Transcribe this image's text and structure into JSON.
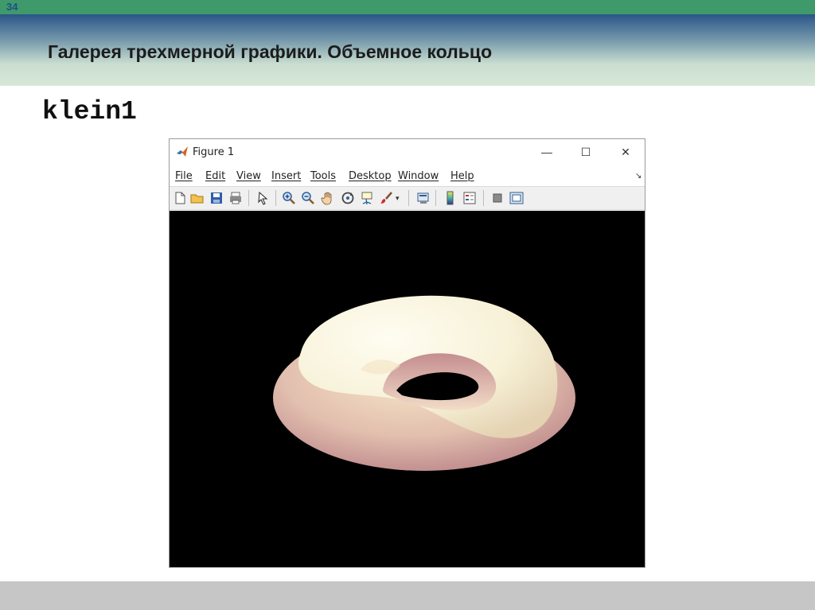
{
  "slide": {
    "number": "34",
    "title": "Галерея трехмерной графики. Объемное кольцо",
    "command": "klein1"
  },
  "figure_window": {
    "title": "Figure 1",
    "controls": {
      "minimize": "—",
      "maximize": "☐",
      "close": "✕"
    },
    "menu": [
      "File",
      "Edit",
      "View",
      "Insert",
      "Tools",
      "Desktop",
      "Window",
      "Help"
    ],
    "dock_arrow": "↘",
    "toolbar_icons": [
      "new-figure-icon",
      "open-file-icon",
      "save-icon",
      "print-icon",
      "edit-plot-arrow-icon",
      "zoom-in-icon",
      "zoom-out-icon",
      "pan-hand-icon",
      "rotate-3d-icon",
      "data-cursor-icon",
      "brush-icon",
      "brush-dropdown-icon",
      "link-plot-icon",
      "insert-colorbar-icon",
      "insert-legend-icon",
      "hide-plot-tools-icon",
      "show-plot-tools-icon"
    ]
  },
  "plot": {
    "background": "#000000",
    "surface_highlight": "#fbf8e6",
    "surface_shadow": "#b87f86"
  },
  "colors": {
    "header_strip": "#3e9a6a",
    "header_dark": "#1e3f73",
    "footer": "#c6c6c6"
  }
}
